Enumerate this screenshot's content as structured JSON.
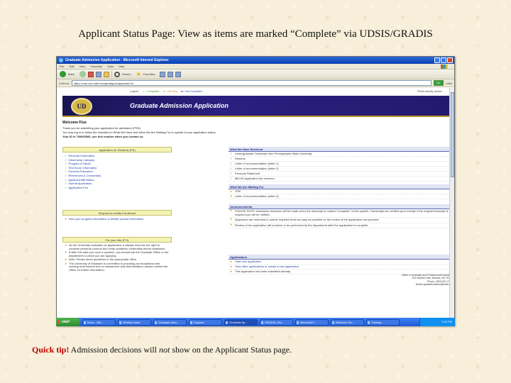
{
  "slide": {
    "title": "Applicant Status Page:  View as items are marked “Complete” via UDSIS/GRADIS",
    "quick_tip_label": "Quick tip!",
    "tip_before": " Admission decisions will ",
    "tip_emphasis": "not",
    "tip_after": " show on the Applicant Status page."
  },
  "browser": {
    "window_title": "Graduate Admission Application - Microsoft Internet Explorer",
    "menu": [
      "File",
      "Edit",
      "View",
      "Favorites",
      "Tools",
      "Help"
    ],
    "toolbar": {
      "back": "Back",
      "search": "Search",
      "favorites": "Favorites"
    },
    "address_label": "Address",
    "url": "https://cms.nss.udel.edu/gradapps/appstatus.do",
    "go": "Go",
    "links": "Links",
    "status_text": "Done",
    "zone_text": "Trusted sites"
  },
  "page": {
    "legend": {
      "label": "Legend:",
      "complete": "✓ = Completed",
      "nonreq": "➤ = Non Req",
      "pending": "■ = Not Completed"
    },
    "print_link": "Printer-friendly version",
    "seal_text": "UD",
    "banner_title": "Graduate Admission Application",
    "welcome_heading": "Welcome Fluo",
    "welcome_lines": [
      "Thank you for submitting your application for admission (PSD).",
      "You may log in to follow the checklist on What We Have and What We Are Waiting For to update of your application status.",
      "Your ID is 700000000, use this number when you contact us."
    ],
    "application_panel": {
      "heading": "Application for Students (PS)",
      "items": [
        "Personal Information",
        "Citizenship Category",
        "Program of Study",
        "Test Score Information",
        "Previous Education",
        "References & Credentials",
        "Applicant Affirmation",
        "Submit Application",
        "Application Fee"
      ]
    },
    "request_panel": {
      "heading": "Request to modify Enrollment",
      "items": [
        "View your program information & Modify Upload Information"
      ]
    },
    "fyi_panel": {
      "heading": "For your info (FYI)",
      "items": [
        "As the University evaluates an application, it always reserves the right to consider personal conduct and verify academic credentials before admission.",
        "If after this date you have a question, you should call the Graduate Office or the department to which you are applying.",
        "Note: Please direct questions to the appropriate office.",
        "The University of Delaware is committed to providing an educational and working environment free of harassment and discrimination; please contact the Office for further information."
      ]
    },
    "received": {
      "heading": "What We Have Received",
      "items": [
        "Undergraduate Transcript from Pennsylvania State University",
        "Resume",
        "Letter of recommendation (letter 1)",
        "Letter of recommendation (letter 2)",
        "Personal Statement",
        "$60.00 Application fee received"
      ]
    },
    "waiting": {
      "heading": "What We Are Waiting For",
      "items": [
        "GRE",
        "Letter of recommendation (letter 3)"
      ]
    },
    "announcements": {
      "heading": "Announcements",
      "items": [
        "PLEASE NOTE: Admission decisions will be made when the transcript is marked \"complete\" in this system. Transcripts are verified upon receipt; if the original transcript is required you will be notified.",
        "Applicants are reminded to submit required items as early as possible so the review of the application can proceed.",
        "Review of the application will continue to be performed by the department after the application is complete."
      ]
    },
    "applications": {
      "heading": "Applications",
      "items": [
        "Start new application",
        "View other applications or create a new application.",
        "This application has been submitted already."
      ]
    },
    "address_lines": [
      "Office of Graduate and Professional Education",
      "234 Hullihen Hall, Newark, DE 19716",
      "Phone: (302) 831-2129",
      "Email: gradadmissions@udel.edu"
    ]
  },
  "taskbar": {
    "start": "start",
    "tasks": [
      "Inbox - Mic...",
      "Weekly report",
      "Graduate Adm...",
      "Explorer",
      "Graduate Ap...",
      "GRADIS_Sta...",
      "Microsoft P...",
      "Welcome Pa...",
      "Training"
    ],
    "clock": "2:03 PM"
  }
}
